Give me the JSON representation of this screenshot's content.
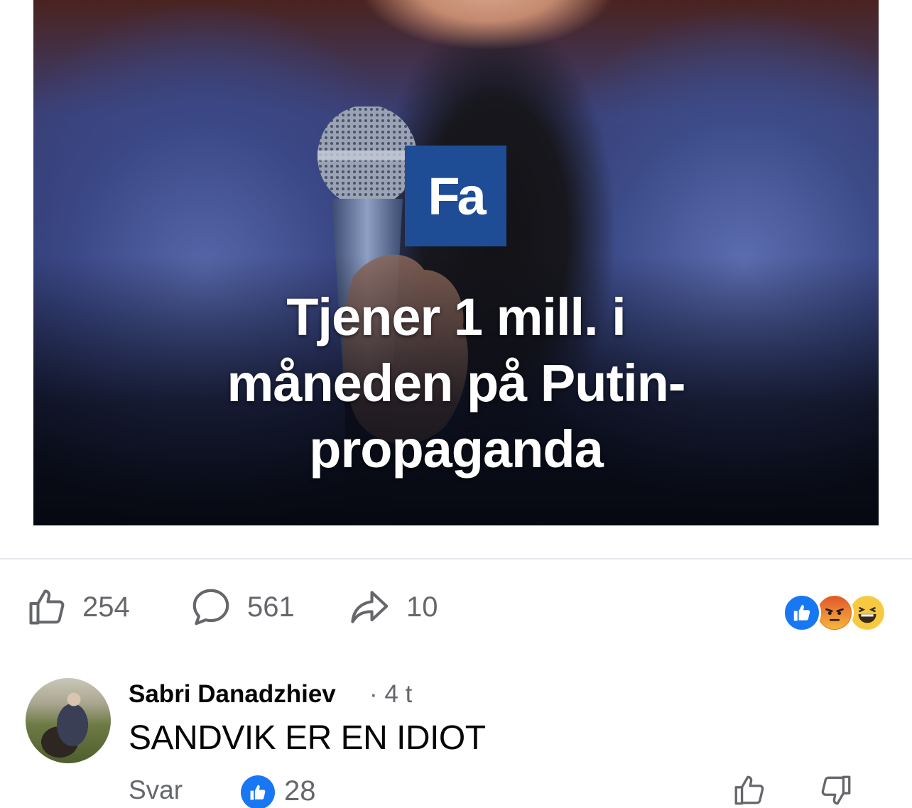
{
  "post": {
    "brand_logo_text": "Fa",
    "headline_lines": [
      "Tjener 1 mill. i",
      "måneden på Putin-",
      "propaganda"
    ],
    "brand_color": "#1e4d96"
  },
  "actions": {
    "like_count": "254",
    "comment_count": "561",
    "share_count": "10",
    "icons": [
      "thumbs-up-icon",
      "comment-bubble-icon",
      "share-arrow-icon"
    ]
  },
  "reactions": [
    "like",
    "angry",
    "haha"
  ],
  "comment": {
    "author": "Sabri Danadzhiev",
    "time": "· 4 t",
    "text": "SANDVIK ER EN IDIOT",
    "reply_label": "Svar",
    "like_count": "28",
    "accent_color": "#1877f2"
  }
}
